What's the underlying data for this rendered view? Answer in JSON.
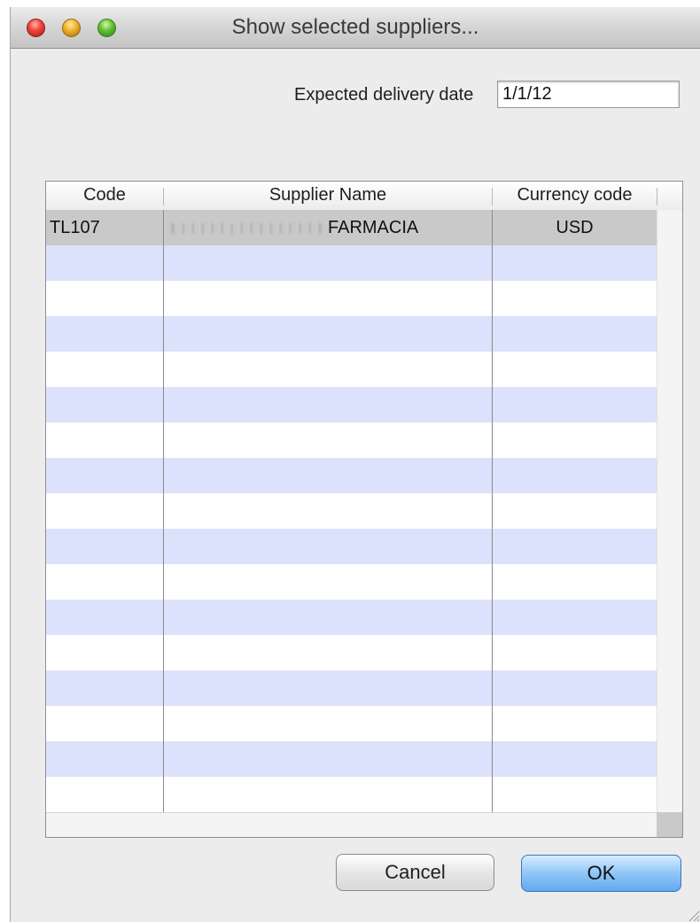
{
  "window": {
    "title": "Show selected suppliers..."
  },
  "form": {
    "expected_delivery_label": "Expected delivery date",
    "expected_delivery_value": "1/1/12"
  },
  "table": {
    "columns": [
      "Code",
      "Supplier Name",
      "Currency code"
    ],
    "rows": [
      {
        "code": "TL107",
        "supplier_name": "FARMACIA",
        "currency": "USD"
      }
    ]
  },
  "buttons": {
    "cancel": "Cancel",
    "ok": "OK"
  },
  "colors": {
    "row_stripe": "#dce1fc",
    "selected_row": "#c9c9c9",
    "ok_button": "#8fc6f7"
  }
}
